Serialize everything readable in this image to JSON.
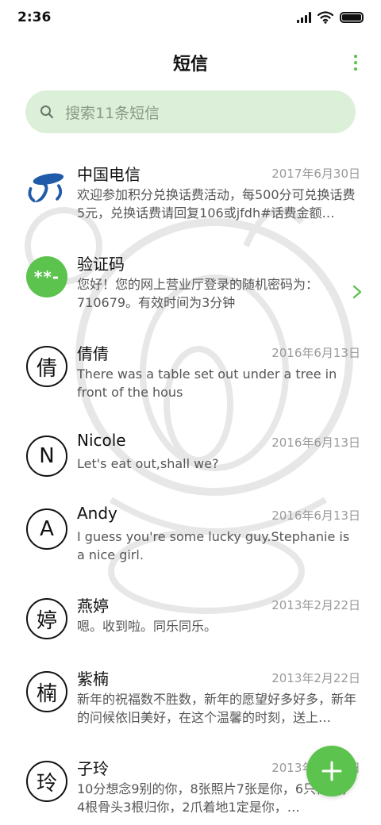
{
  "status_bar": {
    "time": "2:36"
  },
  "header": {
    "title": "短信"
  },
  "search": {
    "placeholder": "搜索11条短信"
  },
  "colors": {
    "accent": "#5cc34e",
    "search_bg": "#dcefd8"
  },
  "conversations": [
    {
      "name": "中国电信",
      "date": "2017年6月30日",
      "preview": "欢迎参加积分兑换话费活动，每500分可兑换话费5元，兑换话费请回复106或jfdh#话费金额…",
      "avatar": "china-telecom-logo"
    },
    {
      "name": "验证码",
      "date": "",
      "preview": "您好！您的网上营业厅登录的随机密码为：710679。有效时间为3分钟",
      "avatar_text": "**-"
    },
    {
      "name": "倩倩",
      "date": "2016年6月13日",
      "preview": "There was a table set out under a tree in front of the hous",
      "avatar_text": "倩"
    },
    {
      "name": "Nicole",
      "date": "2016年6月13日",
      "preview": "Let's eat out,shall we?",
      "avatar_text": "N"
    },
    {
      "name": "Andy",
      "date": "2016年6月13日",
      "preview": "I guess you're some lucky guy.Stephanie is a nice girl.",
      "avatar_text": "A"
    },
    {
      "name": "燕婷",
      "date": "2013年2月22日",
      "preview": "嗯。收到啦。同乐同乐。",
      "avatar_text": "婷"
    },
    {
      "name": "紫楠",
      "date": "2013年2月22日",
      "preview": "新年的祝福数不胜数，新年的愿望好多好多，新年的问候依旧美好，在这个温馨的时刻，送上…",
      "avatar_text": "楠"
    },
    {
      "name": "子玲",
      "date": "2013年2月22日",
      "preview": "10分想念9别的你，8张照片7张是你，6只像你，4根骨头3根归你，2爪着地1定是你，…",
      "avatar_text": "玲"
    }
  ]
}
